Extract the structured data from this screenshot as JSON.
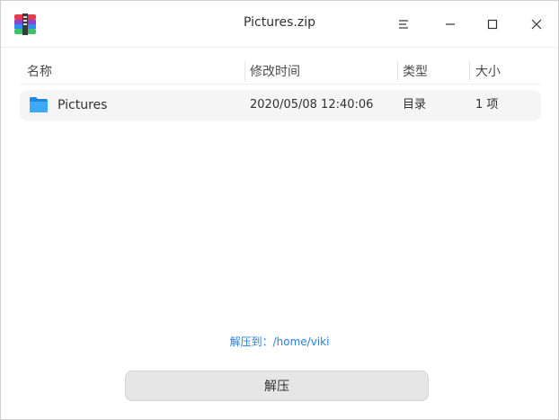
{
  "window": {
    "title": "Pictures.zip"
  },
  "titlebar": {
    "icons": [
      "archive-app-icon",
      "menu-icon",
      "minimize-icon",
      "maximize-icon",
      "close-icon"
    ]
  },
  "table": {
    "columns": [
      "名称",
      "修改时间",
      "类型",
      "大小"
    ],
    "rows": [
      {
        "icon": "folder-icon",
        "name": "Pictures",
        "modified": "2020/05/08 12:40:06",
        "type": "目录",
        "size": "1 项"
      }
    ]
  },
  "footer": {
    "extract_to_label": "解压到：",
    "extract_to_path": "/home/viki",
    "extract_button_label": "解压"
  },
  "colors": {
    "accent": "#2b7ee3",
    "folder": "#2a9bf0",
    "row_background": "#f5f5f5",
    "button_background": "#e6e6e6"
  }
}
